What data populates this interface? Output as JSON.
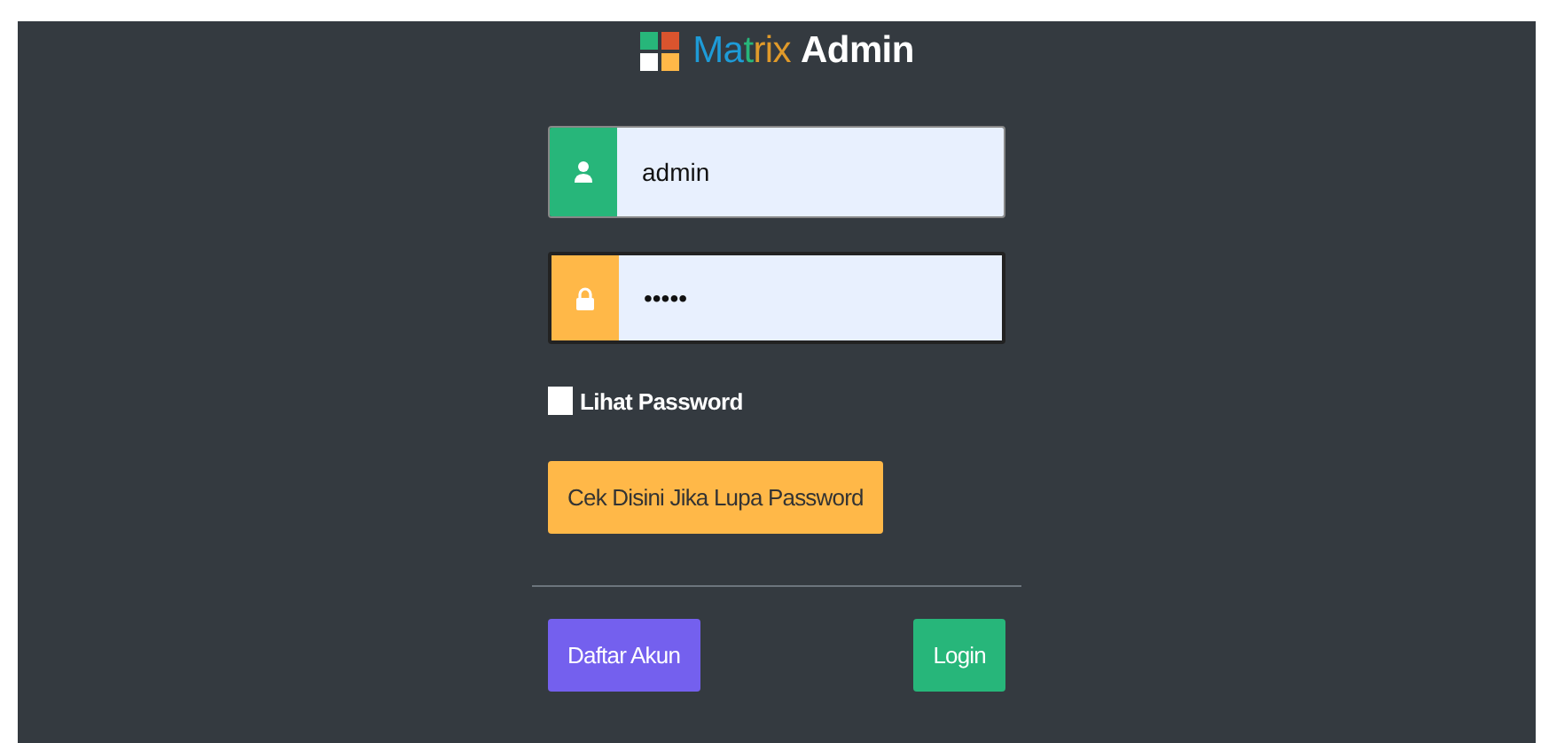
{
  "logo": {
    "parts": [
      {
        "text": "Ma",
        "color": "#1e9bd7"
      },
      {
        "text": "t",
        "color": "#27b67a"
      },
      {
        "text": "rix",
        "color": "#e09a2a"
      }
    ],
    "bold": "Admin"
  },
  "fields": [
    {
      "kind": "user",
      "value": "admin",
      "focused": false
    },
    {
      "kind": "lock",
      "value": "•••••",
      "focused": true
    }
  ],
  "show_password": {
    "label": "Lihat Password",
    "checked": false
  },
  "forgot_button": "Cek Disini Jika Lupa Password",
  "register_button": "Daftar Akun",
  "login_button": "Login"
}
